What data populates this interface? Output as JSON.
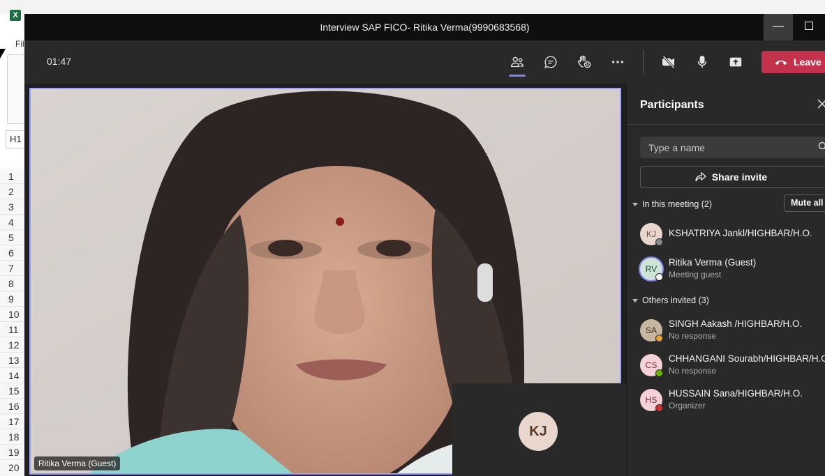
{
  "excel": {
    "logo": "X",
    "file_menu": "File",
    "name_box": "H1",
    "row_numbers": [
      "1",
      "2",
      "3",
      "4",
      "5",
      "6",
      "7",
      "8",
      "9",
      "10",
      "11",
      "12",
      "13",
      "14",
      "15",
      "16",
      "17",
      "18",
      "19",
      "20"
    ]
  },
  "window": {
    "title": "Interview SAP FICO- Ritika Verma(9990683568)",
    "minimize": "—"
  },
  "toolbar": {
    "timer": "01:47",
    "leave_label": "Leave"
  },
  "video": {
    "main_label": "Ritika Verma (Guest)",
    "self_initials": "KJ"
  },
  "panel": {
    "title": "Participants",
    "search_placeholder": "Type a name",
    "share_invite_label": "Share invite",
    "in_meeting_header": "In this meeting (2)",
    "mute_all_label": "Mute all",
    "others_header": "Others invited (3)",
    "in_meeting": [
      {
        "initials": "KJ",
        "name": "KSHATRIYA Jankl/HIGHBAR/H.O.",
        "sub": "",
        "presence": "#8a8a8a",
        "avatar_bg": "#e9d7cd",
        "avatar_fg": "#6a4a3a"
      },
      {
        "initials": "RV",
        "name": "Ritika Verma (Guest)",
        "sub": "Meeting guest",
        "presence": "#ffffff",
        "avatar_bg": "#cfe3d6",
        "avatar_fg": "#1f4b2f"
      }
    ],
    "others": [
      {
        "initials": "SA",
        "name": "SINGH Aakash /HIGHBAR/H.O.",
        "sub": "No response",
        "presence": "#e6a13a",
        "avatar_bg": "#c7b7a0",
        "avatar_fg": "#3a2a1a"
      },
      {
        "initials": "CS",
        "name": "CHHANGANI Sourabh/HIGHBAR/H.O.",
        "sub": "No response",
        "presence": "#6bb700",
        "avatar_bg": "#f4d2d8",
        "avatar_fg": "#8a2a3a"
      },
      {
        "initials": "HS",
        "name": "HUSSAIN Sana/HIGHBAR/H.O.",
        "sub": "Organizer",
        "presence": "#d13438",
        "avatar_bg": "#f4d2d8",
        "avatar_fg": "#8a2a3a"
      }
    ]
  }
}
